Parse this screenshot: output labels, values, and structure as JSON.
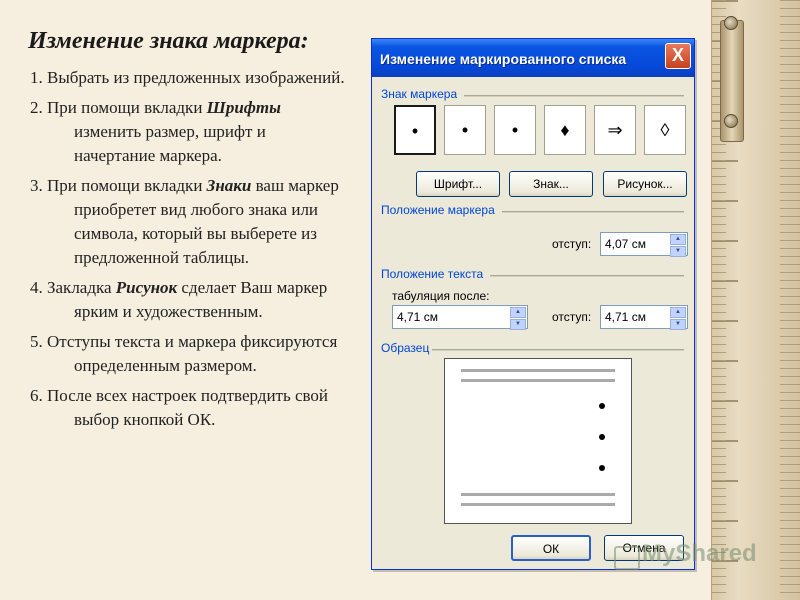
{
  "slide": {
    "title": "Изменение знака маркера:",
    "steps": [
      {
        "num": "1.",
        "pre": "Выбрать из предложенных изображений.",
        "hl": "",
        "post": ""
      },
      {
        "num": "2.",
        "pre": "При помощи вкладки ",
        "hl": "Шрифты",
        "post": " изменить размер, шрифт и начертание маркера."
      },
      {
        "num": "3.",
        "pre": "При помощи вкладки ",
        "hl": "Знаки",
        "post": " ваш маркер приобретет вид любого знака или символа, который вы выберете из предложенной таблицы."
      },
      {
        "num": "4.",
        "pre": "Закладка ",
        "hl": "Рисунок",
        "post": " сделает Ваш маркер ярким и художественным."
      },
      {
        "num": "5.",
        "pre": "Отступы текста и маркера фиксируются определенным размером.",
        "hl": "",
        "post": ""
      },
      {
        "num": "6.",
        "pre": "После всех настроек подтвердить свой выбор кнопкой ОК.",
        "hl": "",
        "post": ""
      }
    ]
  },
  "dialog": {
    "title": "Изменение маркированного списка",
    "close_label": "X",
    "marker_group_label": "Знак маркера",
    "markers": [
      {
        "glyph": "•",
        "selected": true
      },
      {
        "glyph": "•",
        "selected": false
      },
      {
        "glyph": "•",
        "selected": false
      },
      {
        "glyph": "♦",
        "selected": false
      },
      {
        "glyph": "⇒",
        "selected": false
      },
      {
        "glyph": "◊",
        "selected": false
      }
    ],
    "buttons": {
      "font": "Шрифт...",
      "char": "Знак...",
      "picture": "Рисунок...",
      "ok": "ОК",
      "cancel": "Отмена"
    },
    "marker_pos_label": "Положение маркера",
    "indent_label": "отступ:",
    "marker_indent_value": "4,07 см",
    "text_pos_label": "Положение текста",
    "tab_after_label": "табуляция после:",
    "tab_after_value": "4,71 см",
    "text_indent_value": "4,71 см",
    "sample_label": "Образец"
  },
  "watermark": "MyShared",
  "colors": {
    "titlebar": "#0a56e2",
    "dialog_bg": "#ece9d8",
    "group_label": "#0046d5",
    "slide_bg": "#f6eedf"
  }
}
